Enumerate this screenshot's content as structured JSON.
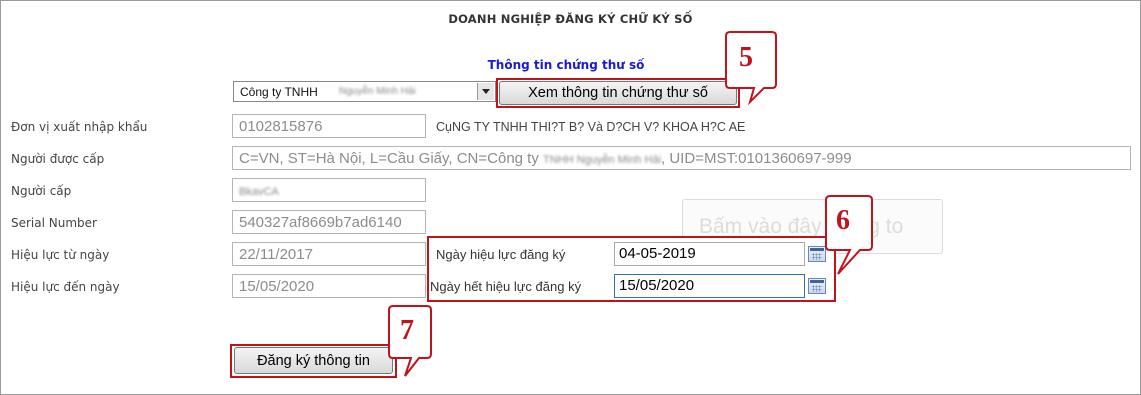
{
  "page": {
    "title": "DOANH NGHIỆP ĐĂNG KÝ CHỮ KÝ SỐ",
    "section_title": "Thông tin chứng thư số"
  },
  "certificate_select": {
    "selected_value": "Công ty TNHH",
    "selected_value_blurred": "Nguyễn Minh Hải"
  },
  "buttons": {
    "view_certificate": "Xem thông tin chứng thư số",
    "register": "Đăng ký thông tin",
    "ghost": "Bấm vào đây để ng to"
  },
  "form": {
    "import_export_unit": {
      "label": "Đơn vị xuất nhập khẩu",
      "value": "0102815876"
    },
    "company_name": "CụNG TY TNHH THI?T B? Và D?CH V? KHOA H?C AE",
    "issued_to": {
      "label": "Người được cấp",
      "value_start": "C=VN, ST=Hà Nội, L=Cầu Giấy, CN=Công ty",
      "value_blurred": "TNHH Nguyễn Minh Hải",
      "value_end": ", UID=MST:0101360697-999"
    },
    "issuer": {
      "label": "Người cấp",
      "value_blurred": "BkavCA"
    },
    "serial_number": {
      "label": "Serial Number",
      "value": "540327af8669b7ad6140"
    },
    "valid_from": {
      "label": "Hiệu lực từ ngày",
      "value": "22/11/2017"
    },
    "valid_to": {
      "label": "Hiệu lực đến ngày",
      "value": "15/05/2020"
    }
  },
  "registration": {
    "start_label": "Ngày hiệu lực đăng ký",
    "start_value": "04-05-2019",
    "end_label": "Ngày hết hiệu lực đăng ký",
    "end_value": "15/05/2020"
  },
  "callouts": {
    "step5": "5",
    "step6": "6",
    "step7": "7"
  },
  "colors": {
    "accent_red": "#c0141c",
    "section_blue": "#1a1ad6"
  }
}
